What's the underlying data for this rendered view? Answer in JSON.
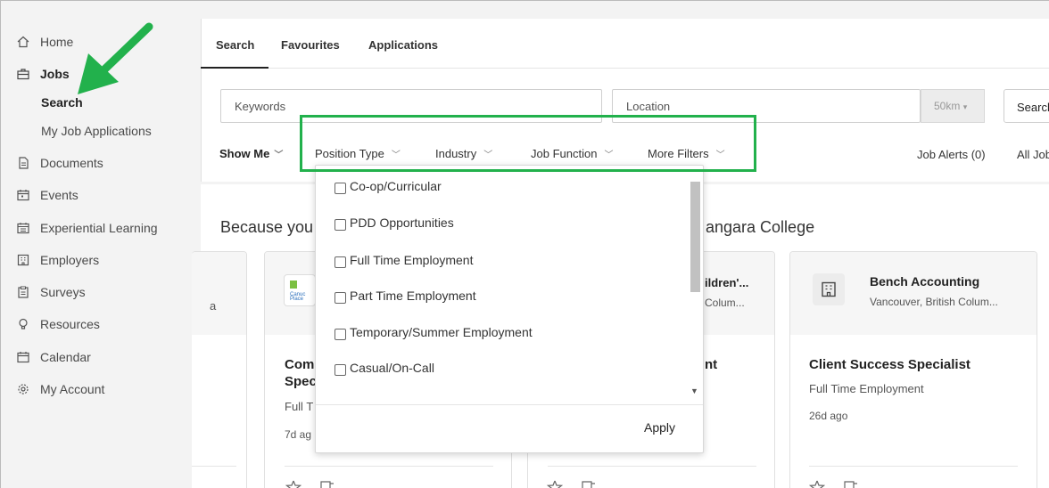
{
  "colors": {
    "accent_green": "#22b14c",
    "text": "#333333",
    "sidebar_bg": "#f3f3f3"
  },
  "sidebar": {
    "items": [
      {
        "label": "Home",
        "icon": "home-icon"
      },
      {
        "label": "Jobs",
        "icon": "briefcase-icon"
      },
      {
        "label": "Documents",
        "icon": "document-icon"
      },
      {
        "label": "Events",
        "icon": "calendar-event-icon"
      },
      {
        "label": "Experiential Learning",
        "icon": "learning-icon"
      },
      {
        "label": "Employers",
        "icon": "building-icon"
      },
      {
        "label": "Surveys",
        "icon": "clipboard-icon"
      },
      {
        "label": "Resources",
        "icon": "lightbulb-icon"
      },
      {
        "label": "Calendar",
        "icon": "calendar-icon"
      },
      {
        "label": "My Account",
        "icon": "gear-icon"
      }
    ],
    "sub_items": [
      {
        "label": "Search"
      },
      {
        "label": "My Job Applications"
      }
    ]
  },
  "tabs": [
    {
      "label": "Search"
    },
    {
      "label": "Favourites"
    },
    {
      "label": "Applications"
    }
  ],
  "search": {
    "keywords_placeholder": "Keywords",
    "location_placeholder": "Location",
    "radius": "50km",
    "button_label": "Search"
  },
  "filters": {
    "show_me": "Show Me",
    "position_type": "Position Type",
    "industry": "Industry",
    "job_function": "Job Function",
    "more_filters": "More Filters",
    "job_alerts": "Job Alerts (0)",
    "all_jobs": "All Jobs"
  },
  "section": {
    "heading_left": "Because you",
    "heading_right": "angara College"
  },
  "cards": [
    {
      "employer_fragment": "a"
    },
    {
      "title_line1": "Com",
      "title_line2": "Spec",
      "type": "Full T",
      "posted": "7d ag"
    },
    {
      "employer_line1": "ildren'...",
      "employer_line2": "Colum...",
      "title": "nt"
    },
    {
      "employer": "Bench Accounting",
      "location": "Vancouver, British Colum...",
      "title": "Client Success Specialist",
      "type": "Full Time Employment",
      "posted": "26d ago"
    }
  ],
  "dropdown": {
    "options": [
      {
        "label": "Co-op/Curricular"
      },
      {
        "label": "PDD Opportunities"
      },
      {
        "label": "Full Time Employment"
      },
      {
        "label": "Part Time Employment"
      },
      {
        "label": "Temporary/Summer Employment"
      },
      {
        "label": "Casual/On-Call"
      }
    ],
    "apply_label": "Apply"
  }
}
